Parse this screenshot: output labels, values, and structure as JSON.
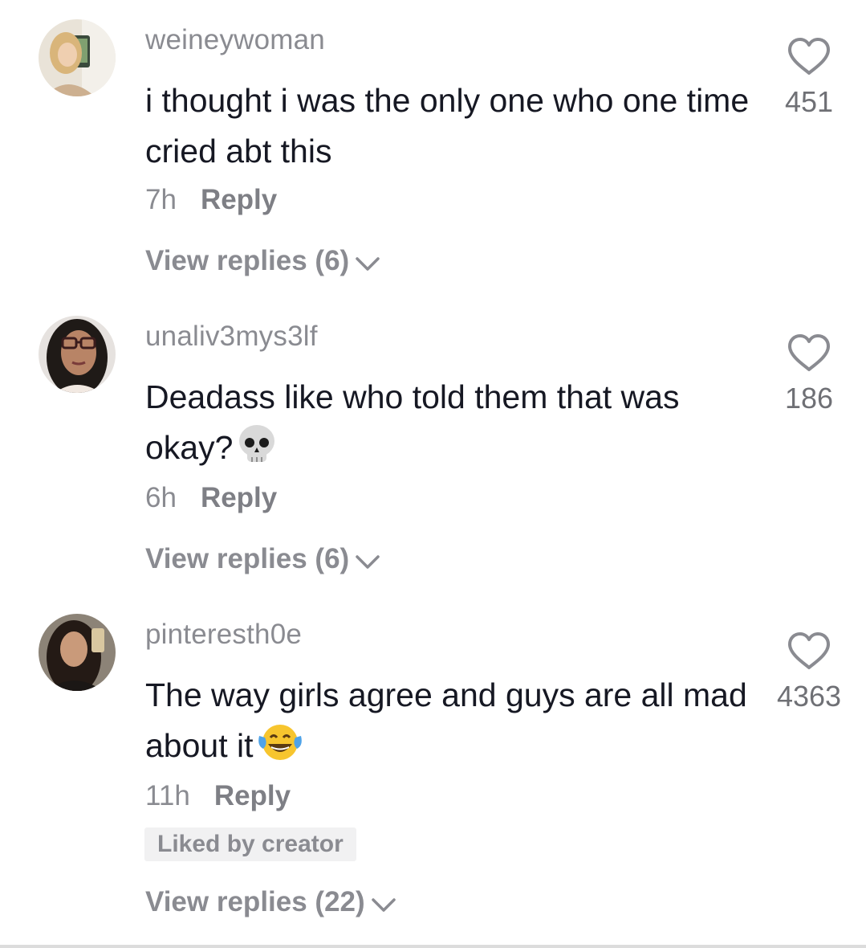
{
  "comments": [
    {
      "username": "weineywoman",
      "text": "i thought i was the only one who one time cried abt this",
      "emoji": "",
      "time": "7h",
      "reply_label": "Reply",
      "likes": "451",
      "liked_by_creator": "",
      "view_replies": "View replies (6)"
    },
    {
      "username": "unaliv3mys3lf",
      "text": "Deadass like who told them that was okay?",
      "emoji": "skull",
      "time": "6h",
      "reply_label": "Reply",
      "likes": "186",
      "liked_by_creator": "",
      "view_replies": "View replies (6)"
    },
    {
      "username": "pinteresth0e",
      "text": "The way girls agree and guys are all mad about it",
      "emoji": "face-with-tears-of-joy",
      "time": "11h",
      "reply_label": "Reply",
      "likes": "4363",
      "liked_by_creator": "Liked by creator",
      "view_replies": "View replies (22)"
    }
  ],
  "icons": {
    "like": "heart-outline-icon",
    "expand": "chevron-down-icon"
  },
  "colors": {
    "text": "#161823",
    "secondary": "#8a8b91",
    "badge_bg": "#f1f1f2"
  }
}
